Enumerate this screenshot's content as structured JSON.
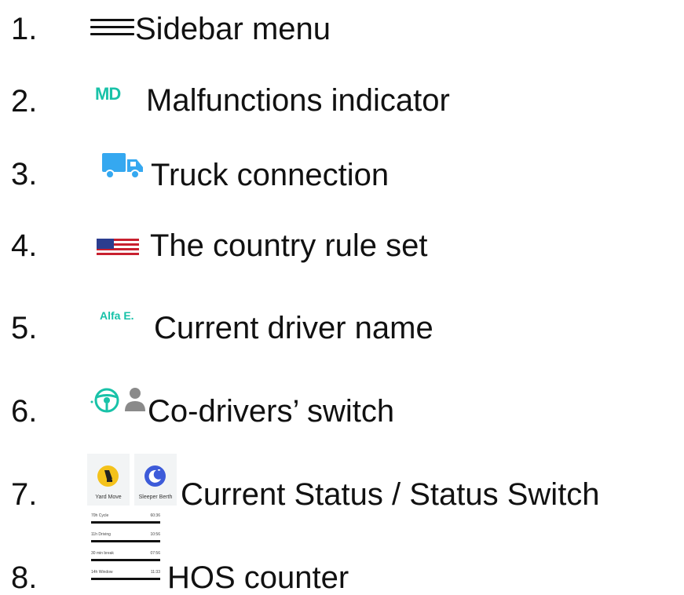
{
  "items": [
    {
      "num": "1.",
      "label": "Sidebar menu",
      "icon": "hamburger-menu-icon"
    },
    {
      "num": "2.",
      "label": "Malfunctions indicator",
      "icon": "md-text-icon",
      "icon_text": "MD"
    },
    {
      "num": "3.",
      "label": "Truck connection",
      "icon": "truck-icon"
    },
    {
      "num": "4.",
      "label": "The country rule set",
      "icon": "us-flag-icon"
    },
    {
      "num": "5.",
      "label": "Current driver name",
      "icon": "driver-name-text",
      "icon_text": "Alfa E."
    },
    {
      "num": "6.",
      "label": "Co-drivers’ switch",
      "icon": "steering-wheel-and-person-icon"
    },
    {
      "num": "7.",
      "label": "Current Status / Status Switch",
      "icon": "status-tiles",
      "tiles": [
        {
          "label": "Yard Move",
          "icon": "yard-move-icon",
          "color": "#f4c21b"
        },
        {
          "label": "Sleeper Berth",
          "icon": "sleeper-berth-icon",
          "color": "#3d5bd9"
        }
      ]
    },
    {
      "num": "8.",
      "label": "HOS counter",
      "icon": "hos-counter-icon",
      "hos": [
        {
          "name": "70h Cycle",
          "value": "60:36"
        },
        {
          "name": "11h Driving",
          "value": "10:56"
        },
        {
          "name": "30 min break",
          "value": "07:56"
        },
        {
          "name": "14h Window",
          "value": "11:33"
        }
      ]
    }
  ],
  "colors": {
    "accent": "#18c2a8",
    "truck": "#35a8f0",
    "text": "#111111"
  }
}
